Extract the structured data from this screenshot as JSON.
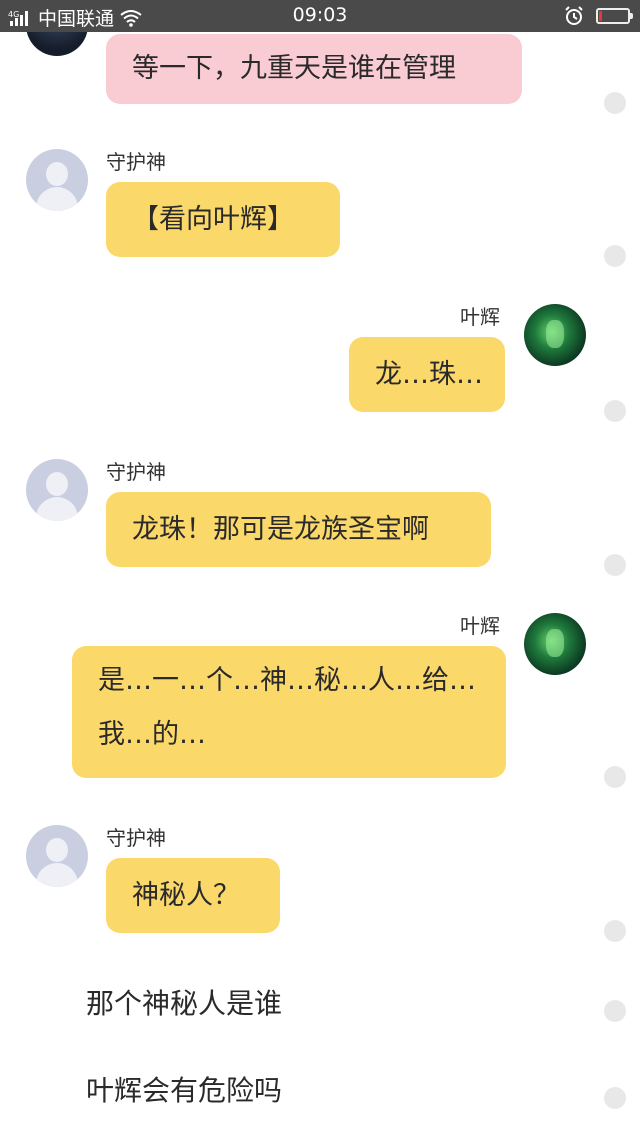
{
  "status_bar": {
    "network": "4G",
    "carrier": "中国联通",
    "time": "09:03",
    "battery_level": 0.1,
    "battery_color": "#e53935"
  },
  "chat": {
    "messages": [
      {
        "sender": "",
        "text": "等一下，九重天是谁在管理",
        "side": "left",
        "style": "pink"
      },
      {
        "sender": "守护神",
        "text": "【看向叶辉】",
        "side": "left"
      },
      {
        "sender": "叶辉",
        "text": "龙…珠…",
        "side": "right"
      },
      {
        "sender": "守护神",
        "text": "龙珠！那可是龙族圣宝啊",
        "side": "left"
      },
      {
        "sender": "叶辉",
        "line1": "是…一…个…神…秘…人…给…",
        "line2": "我…的…",
        "side": "right"
      },
      {
        "sender": "守护神",
        "text": "神秘人？",
        "side": "left"
      }
    ],
    "options": [
      {
        "text": "那个神秘人是谁"
      },
      {
        "text": "叶辉会有危险吗"
      }
    ]
  },
  "colors": {
    "bubble": "#fbd86a",
    "bubble_pink": "#f9cbd3",
    "status_bar": "#4a4a4a"
  }
}
